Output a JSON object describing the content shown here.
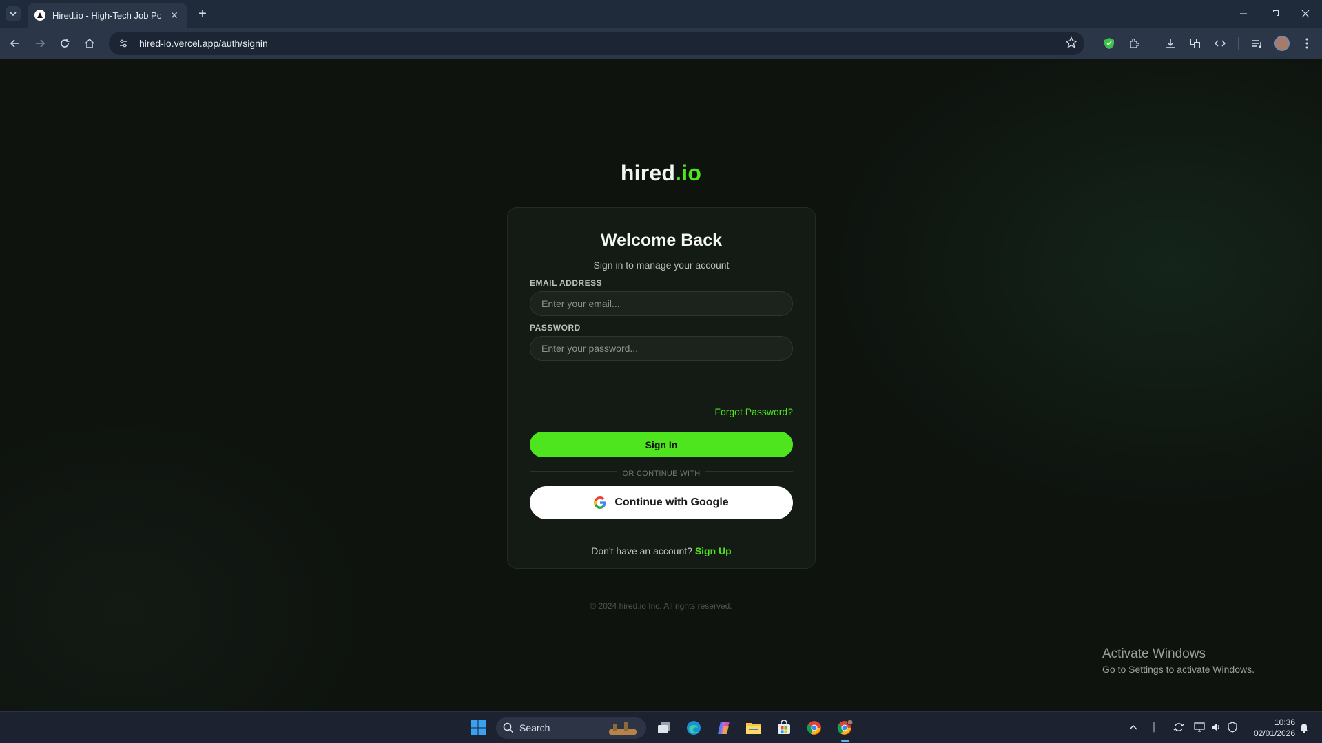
{
  "browser": {
    "tab_title": "Hired.io - High-Tech Job Portal",
    "url": "hired-io.vercel.app/auth/signin"
  },
  "brand": {
    "name_main": "hired",
    "name_accent": ".io",
    "accent_color": "#4ee51f"
  },
  "signin": {
    "title": "Welcome Back",
    "subtitle": "Sign in to manage your account",
    "email_label": "EMAIL ADDRESS",
    "email_placeholder": "Enter your email...",
    "password_label": "PASSWORD",
    "password_placeholder": "Enter your password...",
    "forgot_link": "Forgot Password?",
    "submit_label": "Sign In",
    "divider_text": "OR CONTINUE WITH",
    "google_label": "Continue with Google",
    "signup_prompt": "Don't have an account?",
    "signup_link": "Sign Up"
  },
  "footer": {
    "copyright": "© 2024 hired.io Inc. All rights reserved."
  },
  "watermark": {
    "title": "Activate Windows",
    "subtitle": "Go to Settings to activate Windows."
  },
  "taskbar": {
    "search_label": "Search",
    "time": "10:36",
    "date": "02/01/2026"
  }
}
